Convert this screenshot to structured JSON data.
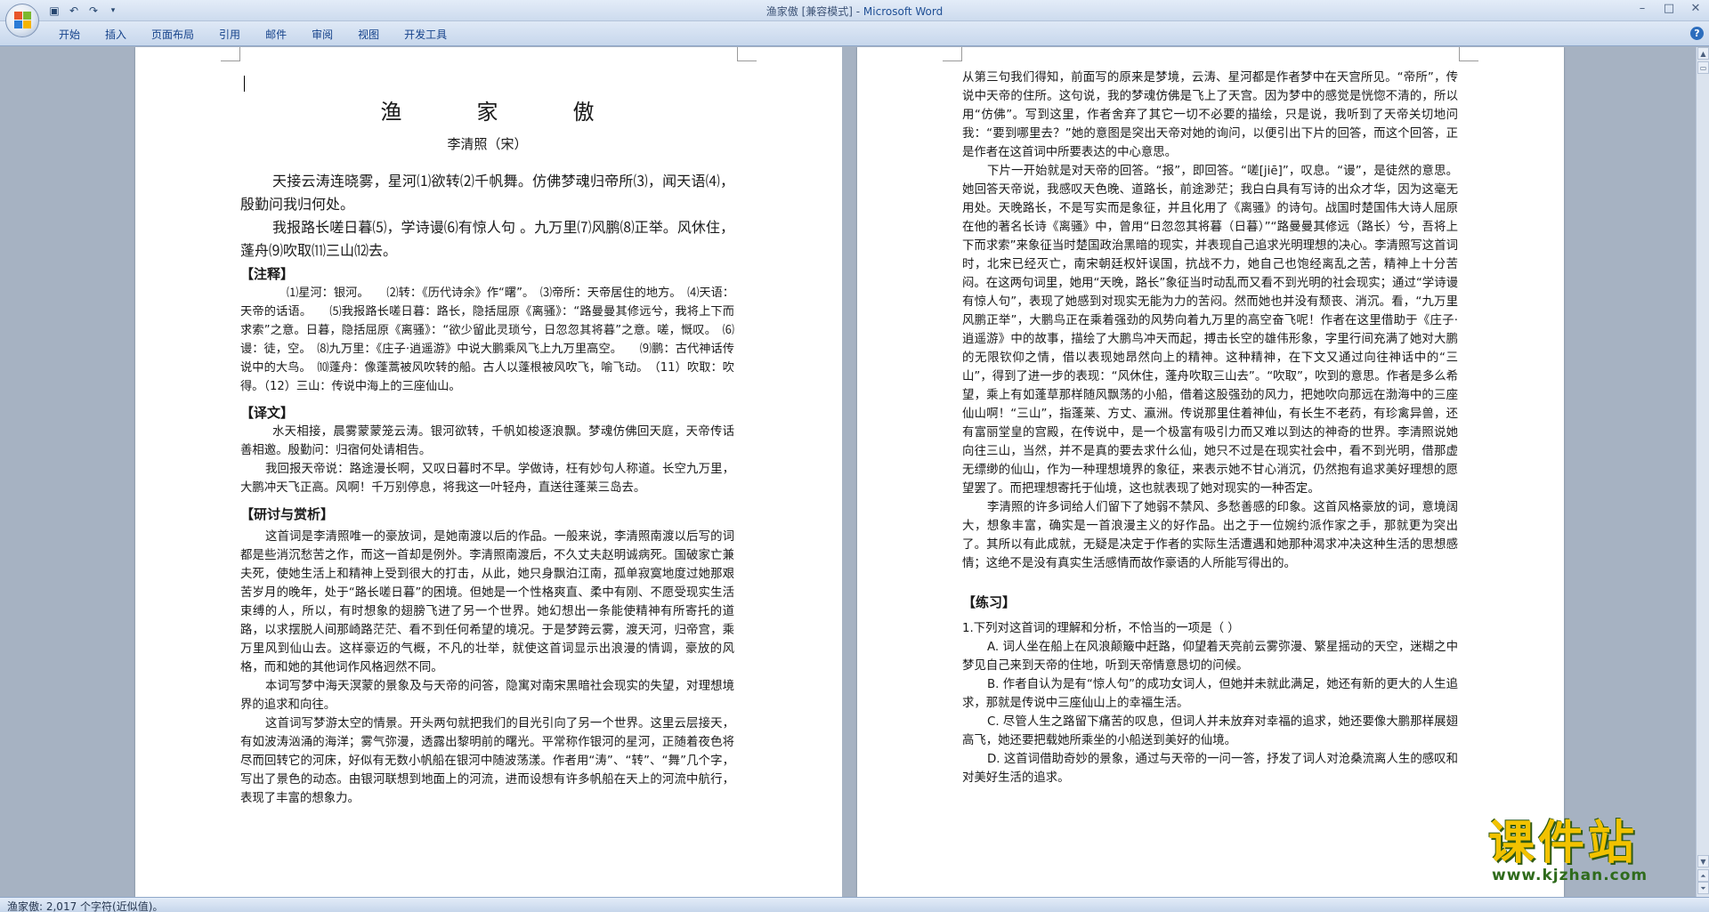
{
  "window": {
    "title_doc": "渔家傲 [兼容模式] - ",
    "title_app": "Microsoft Word"
  },
  "ribbon": {
    "tabs": [
      "开始",
      "插入",
      "页面布局",
      "引用",
      "邮件",
      "审阅",
      "视图",
      "开发工具"
    ]
  },
  "page1": {
    "title": "渔　家　傲",
    "author": "李清照（宋）",
    "poem_lines": [
      "天接云涛连晓雾，星河⑴欲转⑵千帆舞。仿佛梦魂归帝所⑶，闻天语⑷，殷勤问我归何处。",
      "我报路长嗟日暮⑸，学诗谩⑹有惊人句 。九万里⑺风鹏⑻正举。风休住，蓬舟⑼吹取⑾三山⑿去。"
    ],
    "notes_heading": "【注释】",
    "notes": "⑴星河：银河。　　⑵转：《历代诗余》作“曙”。　⑶帝所：天帝居住的地方。　⑷天语：天帝的话语。　　⑸我报路长嗟日暮：路长，隐括屈原《离骚》：“路曼曼其修远兮，我将上下而求索”之意。日暮，隐括屈原《离骚》：“欲少留此灵琐兮，日忽忽其将暮”之意。嗟，慨叹。　⑹谩：徒，空。　⑻九万里：《庄子·逍遥游》中说大鹏乘风飞上九万里高空。　　⑼鹏：古代神话传说中的大鸟。　⑽蓬舟：像蓬蒿被风吹转的船。古人以蓬根被风吹飞，喻飞动。　（11）吹取：吹得。（12）三山：传说中海上的三座仙山。",
    "translation_heading": "【译文】",
    "translation": [
      "水天相接，晨雾蒙蒙笼云涛。银河欲转，千帆如梭逐浪飘。梦魂仿佛回天庭，天帝传话善相邀。殷勤问：归宿何处请相告。",
      "我回报天帝说：路途漫长啊，又叹日暮时不早。学做诗，枉有妙句人称道。长空九万里，大鹏冲天飞正高。风啊！千万别停息，将我这一叶轻舟，直送往蓬莱三岛去。"
    ],
    "analysis_heading": "【研讨与赏析】",
    "analysis": [
      "这首词是李清照唯一的豪放词，是她南渡以后的作品。一般来说，李清照南渡以后写的词都是些消沉愁苦之作，而这一首却是例外。李清照南渡后，不久丈夫赵明诚病死。国破家亡兼夫死，使她生活上和精神上受到很大的打击，从此，她只身飘泊江南，孤单寂寞地度过她那艰苦岁月的晚年，处于“路长嗟日暮”的困境。但她是一个性格爽直、柔中有刚、不愿受现实生活束缚的人，所以，有时想象的翅膀飞进了另一个世界。她幻想出一条能使精神有所寄托的道路，以求摆脱人间那崎路茫茫、看不到任何希望的境况。于是梦跨云雾，渡天河，归帝宫，乘万里风到仙山去。这样豪迈的气概，不凡的壮举，就使这首词显示出浪漫的情调，豪放的风格，而和她的其他词作风格迥然不同。",
      "本词写梦中海天溟蒙的景象及与天帝的问答，隐寓对南宋黑暗社会现实的失望，对理想境界的追求和向往。",
      "这首词写梦游太空的情景。开头两句就把我们的目光引向了另一个世界。这里云层接天，有如波涛汹涌的海洋；雾气弥漫，透露出黎明前的曙光。平常称作银河的星河，正随着夜色将尽而回转它的河床，好似有无数小帆船在银河中随波荡漾。作者用“涛”、“转”、“舞”几个字，写出了景色的动态。由银河联想到地面上的河流，进而设想有许多帆船在天上的河流中航行，表现了丰富的想象力。"
    ]
  },
  "page2": {
    "paragraphs": [
      "从第三句我们得知，前面写的原来是梦境，云涛、星河都是作者梦中在天宫所见。“帝所”，传说中天帝的住所。这句说，我的梦魂仿佛是飞上了天宫。因为梦中的感觉是恍惚不清的，所以用“仿佛”。写到这里，作者舍弃了其它一切不必要的描绘，只是说，我听到了天帝关切地问我：“要到哪里去？”她的意图是突出天帝对她的询问，以便引出下片的回答，而这个回答，正是作者在这首词中所要表达的中心意思。",
      "下片一开始就是对天帝的回答。“报”，即回答。“嗟[jiē]”，叹息。“谩”，是徒然的意思。她回答天帝说，我感叹天色晚、道路长，前途渺茫；我白白具有写诗的出众才华，因为这毫无用处。天晚路长，不是写实而是象征，并且化用了《离骚》的诗句。战国时楚国伟大诗人屈原在他的著名长诗《离骚》中，曾用“日忽忽其将暮（日暮）”“路曼曼其修远（路长）兮，吾将上下而求索”来象征当时楚国政治黑暗的现实，并表现自己追求光明理想的决心。李清照写这首词时，北宋已经灭亡，南宋朝廷权奸误国，抗战不力，她自己也饱经离乱之苦，精神上十分苦闷。在这两句词里，她用“天晚，路长”象征当时动乱而又看不到光明的社会现实；通过“学诗谩有惊人句”，表现了她感到对现实无能为力的苦闷。然而她也并没有颓丧、消沉。看，“九万里风鹏正举”，大鹏鸟正在乘着强劲的风势向着九万里的高空奋飞呢！作者在这里借助于《庄子·逍遥游》中的故事，描绘了大鹏鸟冲天而起，搏击长空的雄伟形象，字里行间充满了她对大鹏的无限钦仰之情，借以表现她昂然向上的精神。这种精神，在下文又通过向往神话中的“三山”，得到了进一步的表现：“风休住，蓬舟吹取三山去”。“吹取”，吹到的意思。作者是多么希望，乘上有如蓬草那样随风飘荡的小船，借着这股强劲的风力，把她吹向那远在渤海中的三座仙山啊！“三山”，指蓬莱、方丈、瀛洲。传说那里住着神仙，有长生不老药，有珍禽异兽，还有富丽堂皇的宫殿，在传说中，是一个极富有吸引力而又难以到达的神奇的世界。李清照说她向往三山，当然，并不是真的要去求什么仙，她只不过是在现实社会中，看不到光明，借那虚无缥缈的仙山，作为一种理想境界的象征，来表示她不甘心消沉，仍然抱有追求美好理想的愿望罢了。而把理想寄托于仙境，这也就表现了她对现实的一种否定。",
      "李清照的许多词给人们留下了她弱不禁风、多愁善感的印象。这首风格豪放的词，意境阔大，想象丰富，确实是一首浪漫主义的好作品。出之于一位婉约派作家之手，那就更为突出了。其所以有此成就，无疑是决定于作者的实际生活遭遇和她那种渴求冲决这种生活的思想感情；这绝不是没有真实生活感情而故作豪语的人所能写得出的。"
    ],
    "exercise_heading": "【练习】",
    "question": "1.下列对这首词的理解和分析，不恰当的一项是（  ）",
    "options": [
      "A. 词人坐在船上在风浪颠簸中赶路，仰望着天亮前云雾弥漫、繁星摇动的天空，迷糊之中梦见自己来到天帝的住地，听到天帝情意恳切的问候。",
      "B. 作者自认为是有“惊人句”的成功女词人，但她并未就此满足，她还有新的更大的人生追求，那就是传说中三座仙山上的幸福生活。",
      "C. 尽管人生之路留下痛苦的叹息，但词人并未放弃对幸福的追求，她还要像大鹏那样展翅高飞，她还要把载她所乘坐的小船送到美好的仙境。",
      "D. 这首词借助奇妙的景象，通过与天帝的一问一答，抒发了词人对沧桑流离人生的感叹和对美好生活的追求。"
    ]
  },
  "status": {
    "text": "渔家傲: 2,017 个字符(近似值)。"
  },
  "watermark": {
    "main": "课件站",
    "url": "www.kjzhan.com"
  }
}
